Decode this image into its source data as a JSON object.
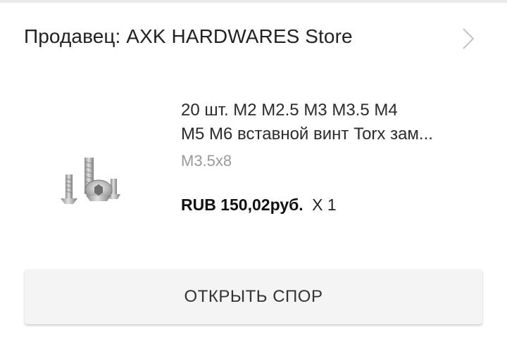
{
  "seller": {
    "label": "Продавец: AXK HARDWARES Store",
    "chevron_icon": "chevron-right-icon"
  },
  "product": {
    "title_line1": "20 шт. M2 M2.5 M3 M3.5 M4",
    "title_line2": "M5 M6 вставной винт Torx зам...",
    "variant": "M3.5x8",
    "price": "RUB 150,02руб.",
    "quantity": "X 1",
    "thumbnail_icon": "screws-thumbnail"
  },
  "actions": {
    "open_dispute_label": "ОТКРЫТЬ СПОР"
  },
  "colors": {
    "background": "#ffffff",
    "button_bg": "#f4f4f4",
    "variant_text": "#9a9a9a"
  }
}
